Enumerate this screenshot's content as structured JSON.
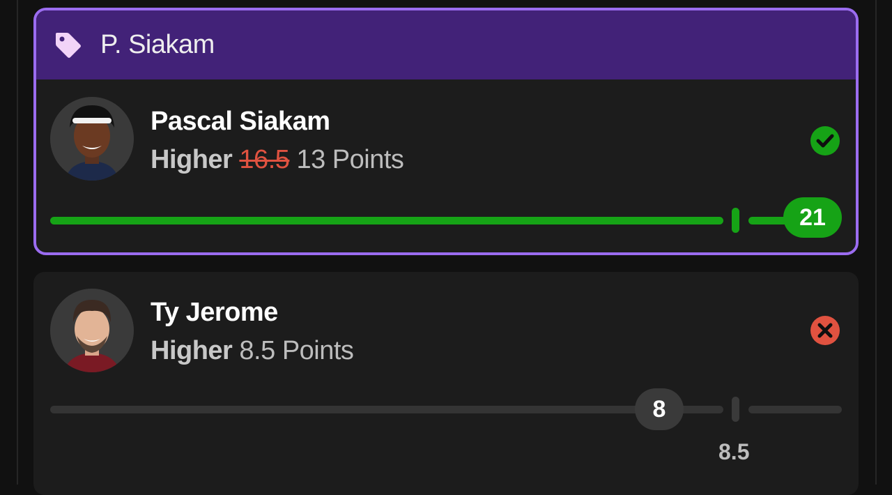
{
  "header": {
    "title": "P. Siakam",
    "icon": "tag-icon"
  },
  "picks": [
    {
      "player_name": "Pascal Siakam",
      "direction": "Higher",
      "original_line": "16.5",
      "line": "13",
      "stat": "Points",
      "result": "won",
      "result_icon": "check-circle-icon",
      "actual_value": "21",
      "progress_fraction": 1.0
    },
    {
      "player_name": "Ty Jerome",
      "direction": "Higher",
      "line": "8.5",
      "stat": "Points",
      "result": "lost",
      "result_icon": "x-circle-icon",
      "actual_value": "8",
      "line_label": "8.5",
      "progress_fraction": 0.94
    }
  ],
  "colors": {
    "accent_purple": "#9b6cf0",
    "header_purple": "#422278",
    "win_green": "#16a316",
    "loss_red": "#e05240"
  }
}
